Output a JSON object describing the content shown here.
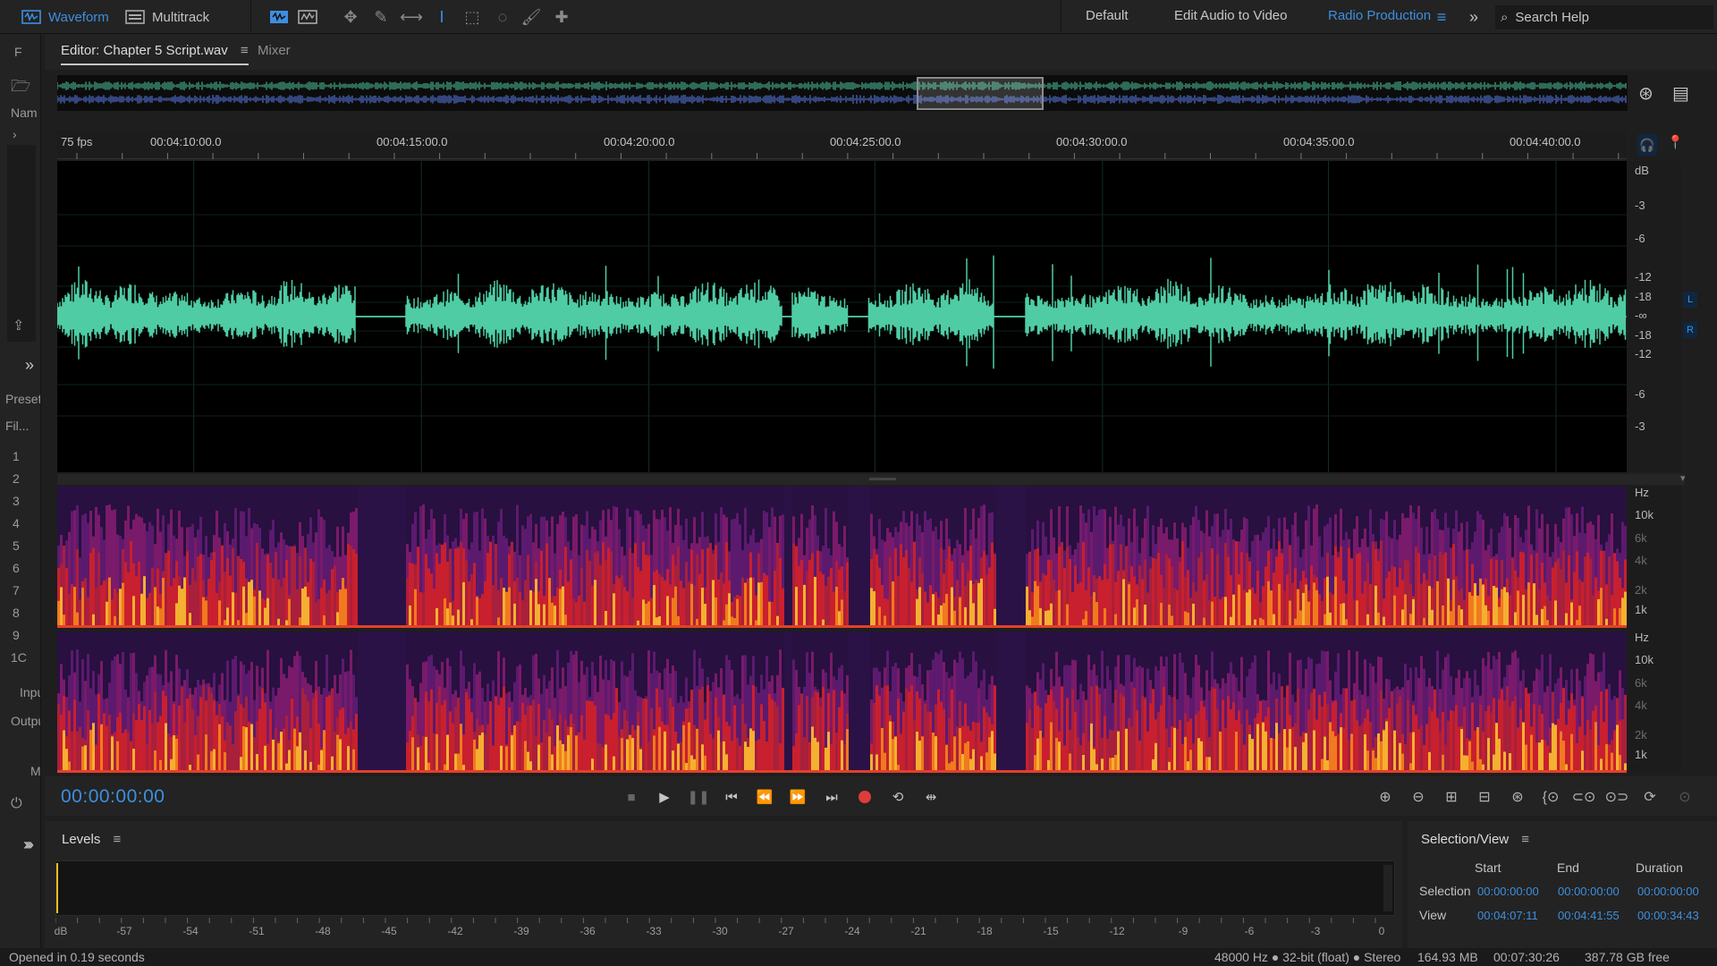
{
  "toolbar": {
    "waveform_label": "Waveform",
    "multitrack_label": "Multitrack",
    "workspaces": [
      "Default",
      "Edit Audio to Video",
      "Radio Production"
    ],
    "search_placeholder": "Search Help"
  },
  "left_panel": {
    "files_initial": "F",
    "name_label": "Nam",
    "presets_label": "Presets",
    "fil_label": "Fil...",
    "input_label": "Inpu",
    "output_label": "Outpu",
    "m_label": "M",
    "tracks": [
      "1",
      "2",
      "3",
      "4",
      "5",
      "6",
      "7",
      "8",
      "9",
      "1C"
    ]
  },
  "editor": {
    "tab_label": "Editor: Chapter 5 Script.wav",
    "mixer_label": "Mixer",
    "ruler_fps": "75 fps",
    "ruler_labels": [
      "00:04:10:00.0",
      "00:04:15:00.0",
      "00:04:20:00.0",
      "00:04:25:00.0",
      "00:04:30:00.0",
      "00:04:35:00.0",
      "00:04:40:00.0"
    ],
    "db_labels": [
      "dB",
      "-3",
      "-6",
      "-12",
      "-18",
      "-∞",
      "-18",
      "-12",
      "-6",
      "-3"
    ],
    "channel_left": "L",
    "channel_right": "R",
    "hz_labels": [
      "Hz",
      "10k",
      "6k",
      "4k",
      "2k",
      "1k"
    ]
  },
  "transport": {
    "timecode": "00:00:00:00"
  },
  "levels": {
    "title": "Levels",
    "scale": [
      "dB",
      "-57",
      "-54",
      "-51",
      "-48",
      "-45",
      "-42",
      "-39",
      "-36",
      "-33",
      "-30",
      "-27",
      "-24",
      "-21",
      "-18",
      "-15",
      "-12",
      "-9",
      "-6",
      "-3",
      "0"
    ]
  },
  "selection_view": {
    "title": "Selection/View",
    "headers": [
      "Start",
      "End",
      "Duration"
    ],
    "selection_label": "Selection",
    "view_label": "View",
    "selection": [
      "00:00:00:00",
      "00:00:00:00",
      "00:00:00:00"
    ],
    "view": [
      "00:04:07:11",
      "00:04:41:55",
      "00:00:34:43"
    ]
  },
  "status": {
    "left": "Opened in 0.19 seconds",
    "format": "48000 Hz ● 32-bit (float) ● Stereo",
    "size": "164.93 MB",
    "duration": "00:07:30:26",
    "free": "387.78 GB free"
  },
  "colors": {
    "accent": "#3d8fe0",
    "waveform": "#4fcca4",
    "overview_left": "#4fcca4",
    "overview_right": "#5d7ff0",
    "record": "#e03b3b",
    "level_indicator": "#e8c21a"
  }
}
